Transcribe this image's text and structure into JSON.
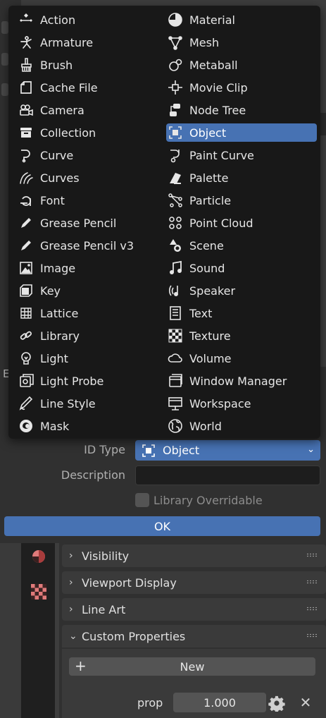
{
  "colors": {
    "menu_bg": "#181818",
    "selection": "#4772b3",
    "panel_bg": "#303030",
    "panel_header": "#3a3a3a",
    "button": "#545454"
  },
  "id_type_menu": {
    "left_column": [
      {
        "label": "Action",
        "icon": "action-icon"
      },
      {
        "label": "Armature",
        "icon": "armature-icon"
      },
      {
        "label": "Brush",
        "icon": "brush-icon"
      },
      {
        "label": "Cache File",
        "icon": "cache-file-icon"
      },
      {
        "label": "Camera",
        "icon": "camera-icon"
      },
      {
        "label": "Collection",
        "icon": "collection-icon"
      },
      {
        "label": "Curve",
        "icon": "curve-icon"
      },
      {
        "label": "Curves",
        "icon": "curves-icon"
      },
      {
        "label": "Font",
        "icon": "font-icon"
      },
      {
        "label": "Grease Pencil",
        "icon": "grease-pencil-icon"
      },
      {
        "label": "Grease Pencil v3",
        "icon": "grease-pencil-v3-icon"
      },
      {
        "label": "Image",
        "icon": "image-icon"
      },
      {
        "label": "Key",
        "icon": "key-icon"
      },
      {
        "label": "Lattice",
        "icon": "lattice-icon"
      },
      {
        "label": "Library",
        "icon": "library-icon"
      },
      {
        "label": "Light",
        "icon": "light-icon"
      },
      {
        "label": "Light Probe",
        "icon": "light-probe-icon"
      },
      {
        "label": "Line Style",
        "icon": "line-style-icon"
      },
      {
        "label": "Mask",
        "icon": "mask-icon"
      }
    ],
    "right_column": [
      {
        "label": "Material",
        "icon": "material-icon"
      },
      {
        "label": "Mesh",
        "icon": "mesh-icon"
      },
      {
        "label": "Metaball",
        "icon": "metaball-icon"
      },
      {
        "label": "Movie Clip",
        "icon": "movie-clip-icon"
      },
      {
        "label": "Node Tree",
        "icon": "node-tree-icon"
      },
      {
        "label": "Object",
        "icon": "object-icon"
      },
      {
        "label": "Paint Curve",
        "icon": "paint-curve-icon"
      },
      {
        "label": "Palette",
        "icon": "palette-icon"
      },
      {
        "label": "Particle",
        "icon": "particle-icon"
      },
      {
        "label": "Point Cloud",
        "icon": "point-cloud-icon"
      },
      {
        "label": "Scene",
        "icon": "scene-icon"
      },
      {
        "label": "Sound",
        "icon": "sound-icon"
      },
      {
        "label": "Speaker",
        "icon": "speaker-icon"
      },
      {
        "label": "Text",
        "icon": "text-icon"
      },
      {
        "label": "Texture",
        "icon": "texture-icon"
      },
      {
        "label": "Volume",
        "icon": "volume-icon"
      },
      {
        "label": "Window Manager",
        "icon": "window-manager-icon"
      },
      {
        "label": "Workspace",
        "icon": "workspace-icon"
      },
      {
        "label": "World",
        "icon": "world-icon"
      }
    ],
    "selected": "Object"
  },
  "dialog": {
    "edge_label": "E",
    "id_type_label": "ID Type",
    "id_type_value": "Object",
    "description_label": "Description",
    "description_value": "",
    "library_overridable_label": "Library Overridable",
    "library_overridable_checked": false,
    "ok_label": "OK"
  },
  "properties": {
    "panels": [
      {
        "label": "Visibility",
        "expanded": false
      },
      {
        "label": "Viewport Display",
        "expanded": false
      },
      {
        "label": "Line Art",
        "expanded": false
      },
      {
        "label": "Custom Properties",
        "expanded": true
      }
    ],
    "new_label": "New",
    "prop_name": "prop",
    "prop_value": "1.000"
  }
}
